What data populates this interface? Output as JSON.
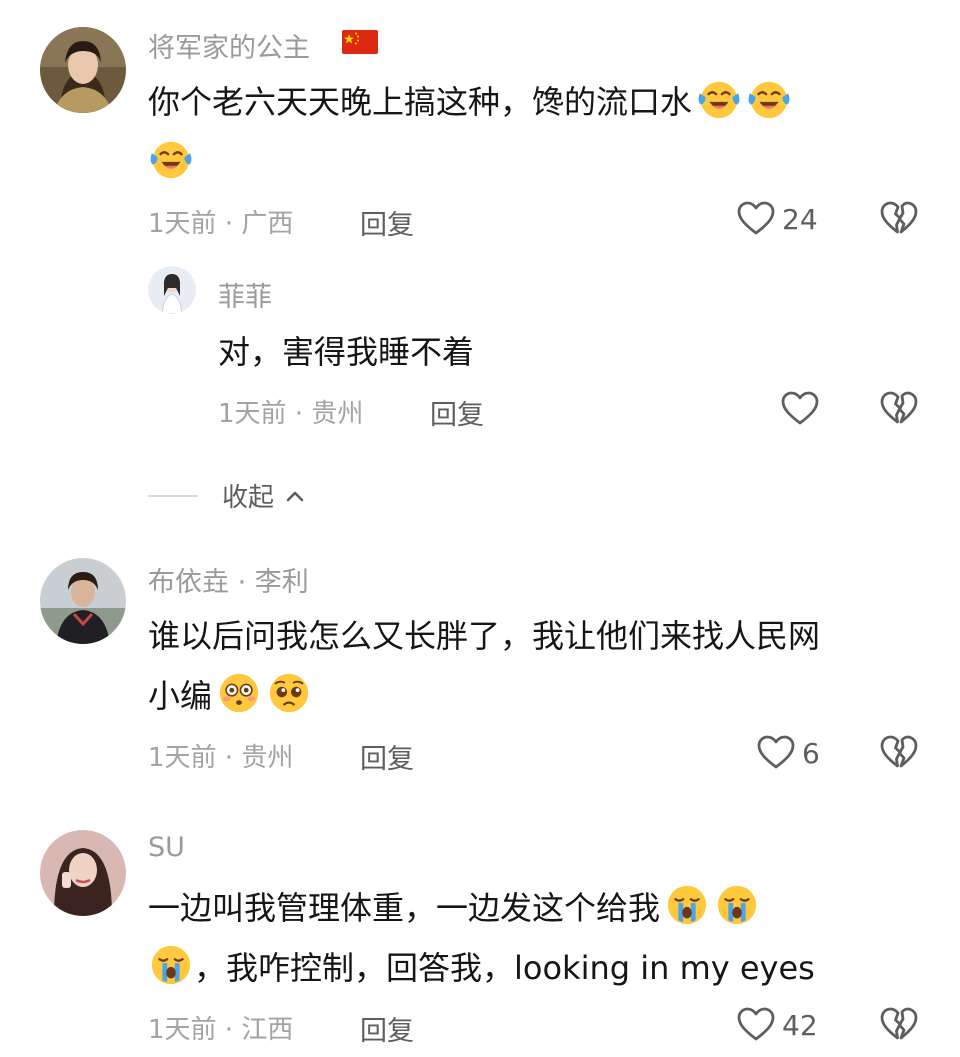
{
  "comments": [
    {
      "username": "将军家的公主",
      "content_line1": "你个老六天天晚上搞这种，馋的流口水",
      "meta": "1天前 · 广西",
      "reply_label": "回复",
      "likes": "24",
      "emojis": [
        "face-with-tears-of-joy",
        "face-with-tears-of-joy",
        "face-with-tears-of-joy"
      ],
      "reply": {
        "username": "菲菲",
        "content": "对，害得我睡不着",
        "meta": "1天前 · 贵州",
        "reply_label": "回复",
        "likes": ""
      },
      "collapse_label": "收起"
    },
    {
      "username": "布依垚 · 李利",
      "content_line1": "谁以后问我怎么又长胖了，我让他们来找人民网",
      "content_line2": "小编",
      "meta": "1天前 · 贵州",
      "reply_label": "回复",
      "likes": "6",
      "emojis": [
        "flushed-face",
        "pleading-face"
      ]
    },
    {
      "username": "SU",
      "content_line1": "一边叫我管理体重，一边发这个给我",
      "content_line2": "，我咋控制，回答我，looking in my eyes",
      "meta": "1天前 · 江西",
      "reply_label": "回复",
      "likes": "42",
      "emojis": [
        "loudly-crying-face",
        "loudly-crying-face",
        "loudly-crying-face"
      ]
    }
  ],
  "colors": {
    "text": "#161616",
    "muted": "#9a9a9a",
    "icon": "#5e5e5e",
    "emoji_yellow": "#ffc83d",
    "tear_blue": "#4aa3f0",
    "flag_red": "#de2910",
    "flag_star": "#ffde00"
  }
}
